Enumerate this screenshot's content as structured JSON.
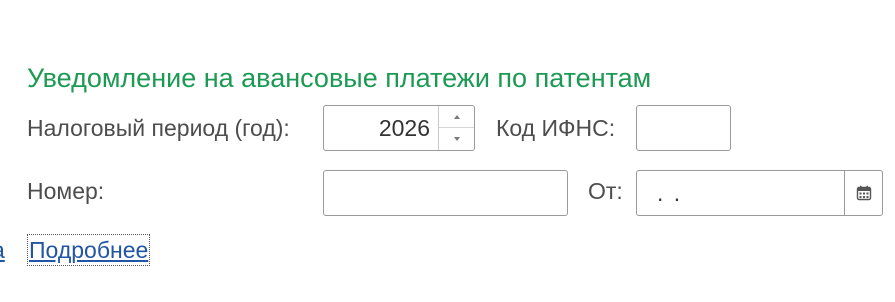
{
  "title": "Уведомление на авансовые платежи по патентам",
  "tax_period": {
    "label": "Налоговый период (год):",
    "value": "2026"
  },
  "ifns": {
    "label": "Код ИФНС:",
    "value": ""
  },
  "number": {
    "label": "Номер:",
    "value": ""
  },
  "date": {
    "label": "От:",
    "value": ". ."
  },
  "links": {
    "partial_left": "а",
    "details": "Подробнее"
  },
  "icons": {
    "stepper_up": "chevron-up-icon",
    "stepper_down": "chevron-down-icon",
    "calendar": "calendar-icon"
  },
  "colors": {
    "title": "#1c9a54",
    "link": "#2355a5",
    "text": "#4d4d4d",
    "border": "#9a9a9a"
  }
}
